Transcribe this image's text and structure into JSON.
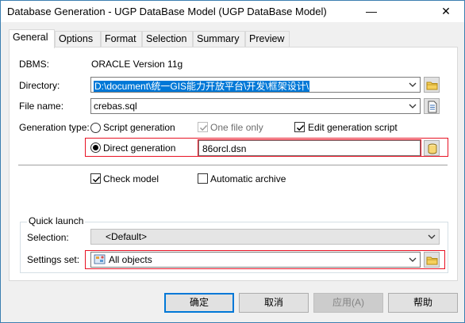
{
  "window": {
    "title": "Database Generation - UGP DataBase Model (UGP DataBase Model)",
    "minimize_glyph": "—",
    "close_glyph": "✕"
  },
  "tabs": [
    {
      "label": "General",
      "active": true
    },
    {
      "label": "Options",
      "active": false
    },
    {
      "label": "Format",
      "active": false
    },
    {
      "label": "Selection",
      "active": false
    },
    {
      "label": "Summary",
      "active": false
    },
    {
      "label": "Preview",
      "active": false
    }
  ],
  "general": {
    "dbms_label": "DBMS:",
    "dbms_value": "ORACLE Version 11g",
    "directory_label": "Directory:",
    "directory_value": "D:\\document\\统一GIS能力开放平台\\开发\\框架设计\\",
    "file_name_label": "File name:",
    "file_name_value": "crebas.sql",
    "generation_type_label": "Generation type:",
    "script_generation_label": "Script generation",
    "script_generation_selected": false,
    "one_file_only_label": "One file only",
    "one_file_only_checked": true,
    "one_file_only_enabled": false,
    "edit_generation_script_label": "Edit generation script",
    "edit_generation_script_checked": true,
    "direct_generation_label": "Direct generation",
    "direct_generation_selected": true,
    "data_source_value": "86orcl.dsn",
    "check_model_label": "Check model",
    "check_model_checked": true,
    "automatic_archive_label": "Automatic archive",
    "automatic_archive_checked": false
  },
  "quick_launch": {
    "title": "Quick launch",
    "selection_label": "Selection:",
    "selection_value": "<Default>",
    "settings_set_label": "Settings set:",
    "settings_set_value": "All objects"
  },
  "buttons": {
    "ok": "确定",
    "cancel": "取消",
    "apply": "应用(A)",
    "help": "帮助"
  },
  "colors": {
    "accent": "#0078d7",
    "highlight_border": "#e81123",
    "window_border": "#3c7fb1"
  }
}
